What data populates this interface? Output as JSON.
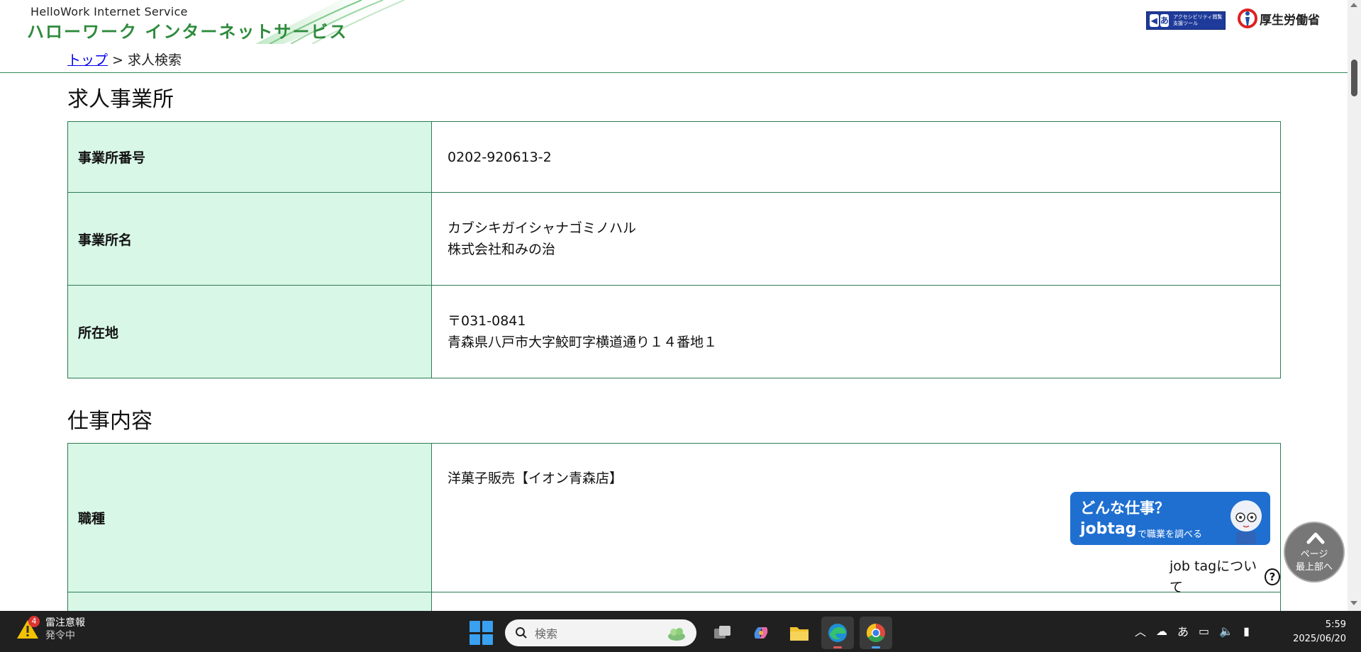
{
  "header": {
    "logo_en": "HelloWork Internet Service",
    "logo_ja": "ハローワーク インターネットサービス",
    "access_tool_text": "アクセシビリティ閲覧支援ツール",
    "access_tool_icon": "あ",
    "mhlw_name": "厚生労働省"
  },
  "breadcrumb": {
    "top_link": "トップ",
    "separator": " > ",
    "current": "求人検索"
  },
  "sections": {
    "office": {
      "title": "求人事業所",
      "rows": [
        {
          "label": "事業所番号",
          "value": "0202-920613-2"
        },
        {
          "label": "事業所名",
          "value_line1": "カブシキガイシャナゴミノハル",
          "value_line2": "株式会社和みの治"
        },
        {
          "label": "所在地",
          "value_line1": "〒031-0841",
          "value_line2": "青森県八戸市大字鮫町字横道通り１４番地１"
        }
      ]
    },
    "job": {
      "title": "仕事内容",
      "rows": [
        {
          "label": "職種",
          "value": "洋菓子販売【イオン青森店】"
        }
      ]
    }
  },
  "jobtag": {
    "banner_line1": "どんな仕事？",
    "banner_brand": "jobtag",
    "banner_sub": "で職業を調べる",
    "about_text": "job tagについて",
    "help_icon": "?"
  },
  "pagetop": {
    "line1": "ページ",
    "line2": "最上部へ"
  },
  "taskbar": {
    "weather_badge": "4",
    "weather_title": "雷注意報",
    "weather_sub": "発令中",
    "search_placeholder": "検索",
    "ime": "あ",
    "time": "5:59",
    "date": "2025/06/20"
  },
  "colors": {
    "brand_green": "#2e8b3d",
    "table_header_bg": "#d8f7e7",
    "table_border": "#2e7a52",
    "jobtag_blue": "#1f6fd1",
    "link_blue": "#0000ee"
  }
}
